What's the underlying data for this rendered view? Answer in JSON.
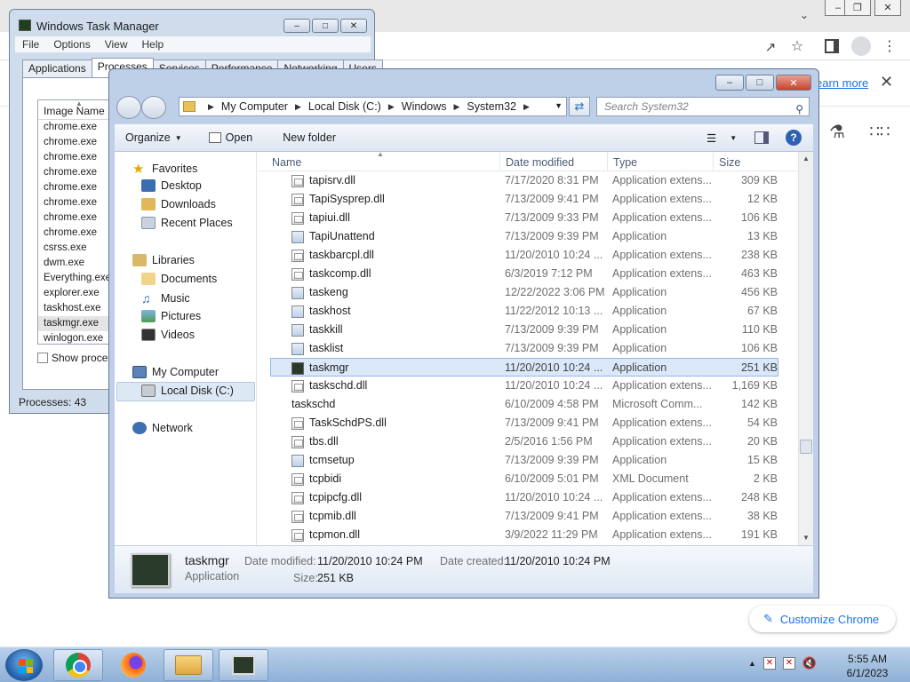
{
  "chrome": {
    "learn_more": "earn more",
    "customize_label": "Customize Chrome"
  },
  "task_manager": {
    "title": "Windows Task Manager",
    "menu": [
      "File",
      "Options",
      "View",
      "Help"
    ],
    "tabs": [
      "Applications",
      "Processes",
      "Services",
      "Performance",
      "Networking",
      "Users"
    ],
    "column_header": "Image Name",
    "processes": [
      "chrome.exe",
      "chrome.exe",
      "chrome.exe",
      "chrome.exe",
      "chrome.exe",
      "chrome.exe",
      "chrome.exe",
      "chrome.exe",
      "csrss.exe",
      "dwm.exe",
      "Everything.exe",
      "explorer.exe",
      "taskhost.exe",
      "taskmgr.exe",
      "winlogon.exe"
    ],
    "selected_process": "taskmgr.exe",
    "show_processes": "Show process",
    "status": "Processes: 43"
  },
  "explorer": {
    "breadcrumb": [
      "My Computer",
      "Local Disk (C:)",
      "Windows",
      "System32"
    ],
    "search_placeholder": "Search System32",
    "toolbar": {
      "organize": "Organize",
      "open": "Open",
      "new_folder": "New folder"
    },
    "nav": {
      "favorites": "Favorites",
      "desktop": "Desktop",
      "downloads": "Downloads",
      "recent": "Recent Places",
      "libraries": "Libraries",
      "documents": "Documents",
      "music": "Music",
      "pictures": "Pictures",
      "videos": "Videos",
      "computer": "My Computer",
      "local_disk": "Local Disk (C:)",
      "network": "Network"
    },
    "columns": {
      "name": "Name",
      "date": "Date modified",
      "type": "Type",
      "size": "Size"
    },
    "files": [
      {
        "name": "tapisrv.dll",
        "date": "7/17/2020 8:31 PM",
        "type": "Application extens...",
        "size": "309 KB",
        "icon": "dll"
      },
      {
        "name": "TapiSysprep.dll",
        "date": "7/13/2009 9:41 PM",
        "type": "Application extens...",
        "size": "12 KB",
        "icon": "dll"
      },
      {
        "name": "tapiui.dll",
        "date": "7/13/2009 9:33 PM",
        "type": "Application extens...",
        "size": "106 KB",
        "icon": "dll"
      },
      {
        "name": "TapiUnattend",
        "date": "7/13/2009 9:39 PM",
        "type": "Application",
        "size": "13 KB",
        "icon": "exe"
      },
      {
        "name": "taskbarcpl.dll",
        "date": "11/20/2010 10:24 ...",
        "type": "Application extens...",
        "size": "238 KB",
        "icon": "dll"
      },
      {
        "name": "taskcomp.dll",
        "date": "6/3/2019 7:12 PM",
        "type": "Application extens...",
        "size": "463 KB",
        "icon": "dll"
      },
      {
        "name": "taskeng",
        "date": "12/22/2022 3:06 PM",
        "type": "Application",
        "size": "456 KB",
        "icon": "exe"
      },
      {
        "name": "taskhost",
        "date": "11/22/2012 10:13 ...",
        "type": "Application",
        "size": "67 KB",
        "icon": "exe"
      },
      {
        "name": "taskkill",
        "date": "7/13/2009 9:39 PM",
        "type": "Application",
        "size": "110 KB",
        "icon": "exe"
      },
      {
        "name": "tasklist",
        "date": "7/13/2009 9:39 PM",
        "type": "Application",
        "size": "106 KB",
        "icon": "exe"
      },
      {
        "name": "taskmgr",
        "date": "11/20/2010 10:24 ...",
        "type": "Application",
        "size": "251 KB",
        "icon": "app"
      },
      {
        "name": "taskschd.dll",
        "date": "11/20/2010 10:24 ...",
        "type": "Application extens...",
        "size": "1,169 KB",
        "icon": "dll"
      },
      {
        "name": "taskschd",
        "date": "6/10/2009 4:58 PM",
        "type": "Microsoft Comm...",
        "size": "142 KB",
        "icon": "clock"
      },
      {
        "name": "TaskSchdPS.dll",
        "date": "7/13/2009 9:41 PM",
        "type": "Application extens...",
        "size": "54 KB",
        "icon": "dll"
      },
      {
        "name": "tbs.dll",
        "date": "2/5/2016 1:56 PM",
        "type": "Application extens...",
        "size": "20 KB",
        "icon": "dll"
      },
      {
        "name": "tcmsetup",
        "date": "7/13/2009 9:39 PM",
        "type": "Application",
        "size": "15 KB",
        "icon": "exe"
      },
      {
        "name": "tcpbidi",
        "date": "6/10/2009 5:01 PM",
        "type": "XML Document",
        "size": "2 KB",
        "icon": "dll"
      },
      {
        "name": "tcpipcfg.dll",
        "date": "11/20/2010 10:24 ...",
        "type": "Application extens...",
        "size": "248 KB",
        "icon": "dll"
      },
      {
        "name": "tcpmib.dll",
        "date": "7/13/2009 9:41 PM",
        "type": "Application extens...",
        "size": "38 KB",
        "icon": "dll"
      },
      {
        "name": "tcpmon.dll",
        "date": "3/9/2022 11:29 PM",
        "type": "Application extens...",
        "size": "191 KB",
        "icon": "dll"
      }
    ],
    "selected_file": "taskmgr",
    "details": {
      "name": "taskmgr",
      "type": "Application",
      "date_modified_label": "Date modified:",
      "date_modified": "11/20/2010 10:24 PM",
      "date_created_label": "Date created:",
      "date_created": "11/20/2010 10:24 PM",
      "size_label": "Size:",
      "size": "251 KB"
    }
  },
  "taskbar": {
    "time": "5:55 AM",
    "date": "6/1/2023"
  }
}
